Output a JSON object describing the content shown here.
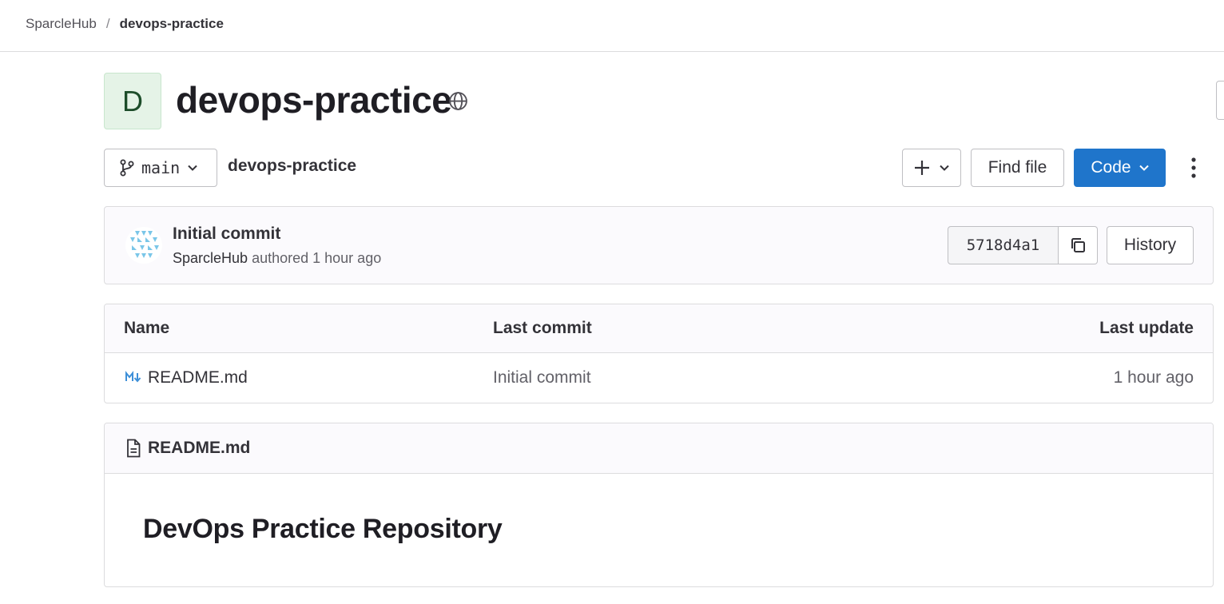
{
  "breadcrumb": {
    "group": "SparcleHub",
    "separator": "/",
    "project": "devops-practice"
  },
  "project": {
    "avatar_letter": "D",
    "name": "devops-practice",
    "visibility_icon": "globe-icon"
  },
  "toolbar": {
    "branch": "main",
    "repo_path": "devops-practice",
    "add_icon": "plus-icon",
    "find_file": "Find file",
    "code": "Code"
  },
  "commit": {
    "title": "Initial commit",
    "author": "SparcleHub",
    "meta": "authored 1 hour ago",
    "sha": "5718d4a1",
    "history": "History"
  },
  "file_table": {
    "columns": [
      "Name",
      "Last commit",
      "Last update"
    ],
    "rows": [
      {
        "name": "README.md",
        "last_commit": "Initial commit",
        "last_update": "1 hour ago",
        "icon": "markdown-icon"
      }
    ]
  },
  "readme": {
    "title": "README.md",
    "heading": "DevOps Practice Repository"
  },
  "colors": {
    "primary": "#1f75cb",
    "avatar_bg": "#e5f3e7",
    "border": "#dcdcde"
  }
}
